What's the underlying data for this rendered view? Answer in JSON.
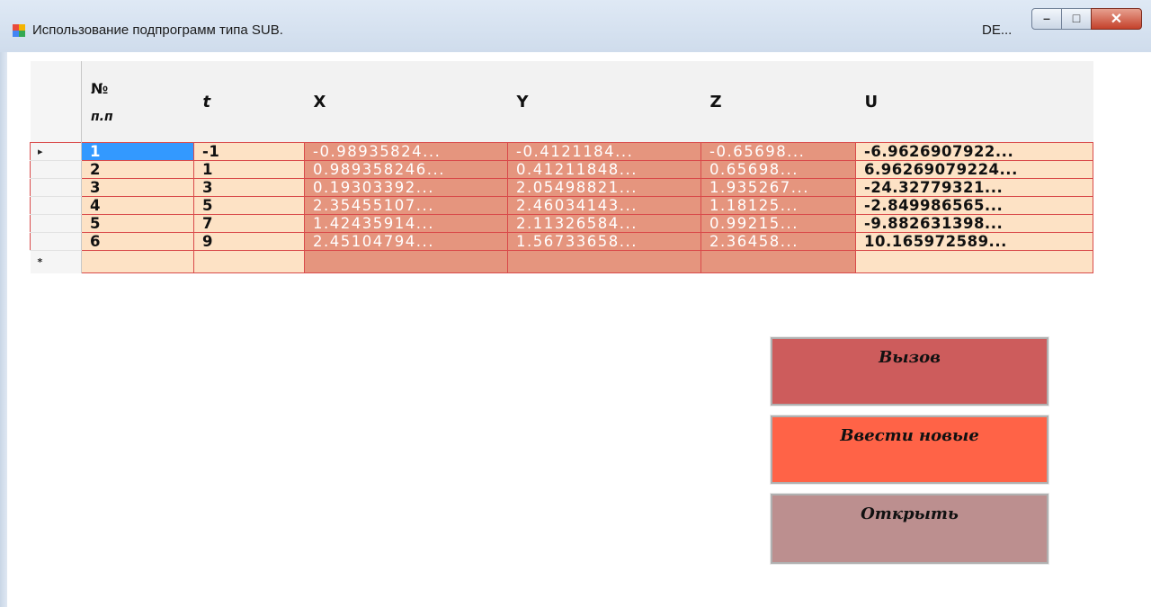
{
  "window": {
    "title": "Использование подпрограмм типа SUB.",
    "title_right": "DE...",
    "controls": {
      "minimize": "–",
      "maximize": "□",
      "close": "✕"
    }
  },
  "grid": {
    "columns": [
      {
        "top": "№",
        "bottom": "п.п"
      },
      {
        "label": "t"
      },
      {
        "label": "X"
      },
      {
        "label": "Y"
      },
      {
        "label": "Z"
      },
      {
        "label": "U"
      }
    ],
    "current_row_marker": "▸",
    "new_row_marker": "*",
    "rows": [
      [
        "1",
        "-1",
        "-0.98935824...",
        "-0.4121184...",
        "-0.65698...",
        "-6.9626907922..."
      ],
      [
        "2",
        "1",
        "0.989358246...",
        "0.41211848...",
        "0.65698...",
        "6.96269079224..."
      ],
      [
        "3",
        "3",
        "0.19303392...",
        "2.05498821...",
        "1.935267...",
        "-24.32779321..."
      ],
      [
        "4",
        "5",
        "2.35455107...",
        "2.46034143...",
        "1.18125...",
        "-2.849986565..."
      ],
      [
        "5",
        "7",
        "1.42435914...",
        "2.11326584...",
        "0.99215...",
        "-9.882631398..."
      ],
      [
        "6",
        "9",
        "2.45104794...",
        "1.56733658...",
        "2.36458...",
        "10.165972589..."
      ]
    ]
  },
  "buttons": {
    "call": "Вызов",
    "enter_new": "Ввести новые",
    "open": "Открыть"
  },
  "colors": {
    "peach": "#fde2c5",
    "salmon": "#e5957e",
    "grid_line": "#d94a4a",
    "selection": "#3399ff",
    "btn_call": "#cd5c5c",
    "btn_enter_new": "#ff6347",
    "btn_open": "#bc8f8f"
  }
}
